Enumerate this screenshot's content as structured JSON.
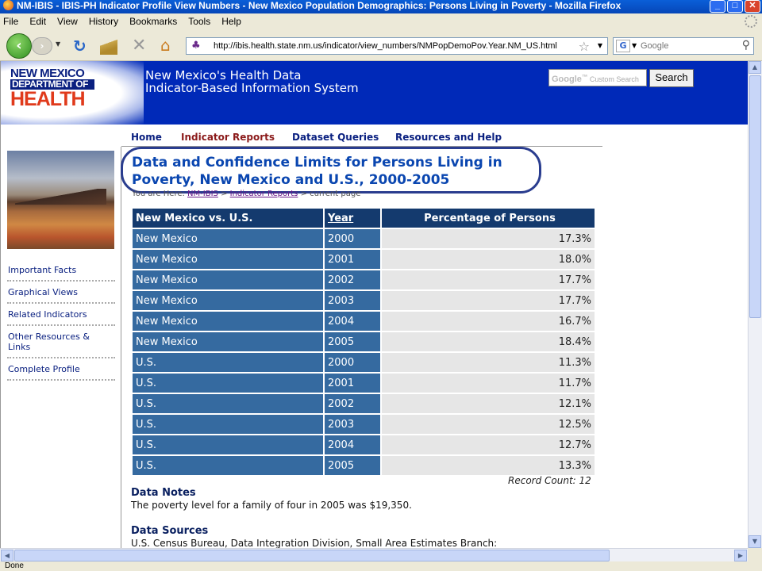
{
  "window": {
    "title": "NM-IBIS - IBIS-PH Indicator Profile View Numbers - New Mexico Population Demographics: Persons Living in Poverty - Mozilla Firefox"
  },
  "menu": [
    "File",
    "Edit",
    "View",
    "History",
    "Bookmarks",
    "Tools",
    "Help"
  ],
  "toolbar": {
    "url": "http://ibis.health.state.nm.us/indicator/view_numbers/NMPopDemoPov.Year.NM_US.html",
    "search_placeholder": "Google"
  },
  "site": {
    "logo_line1": "NEW MEXICO",
    "logo_line2": "DEPARTMENT OF",
    "logo_line3": "HEALTH",
    "title_line1": "New Mexico's Health Data",
    "title_line2": "Indicator-Based Information System",
    "search_hint": "Custom Search",
    "search_brand": "Google",
    "search_button": "Search"
  },
  "nav": {
    "home": "Home",
    "indicator_reports": "Indicator Reports",
    "dataset_queries": "Dataset Queries",
    "resources": "Resources and Help"
  },
  "sidebar": {
    "links": [
      "Important Facts",
      "Graphical Views",
      "Related Indicators",
      "Other Resources & Links",
      "Complete Profile"
    ]
  },
  "page": {
    "title": "Data and Confidence Limits for Persons Living in Poverty, New Mexico and U.S., 2000-2005",
    "breadcrumb_prefix": "You are Here:",
    "breadcrumb_1": "NM-IBIS",
    "breadcrumb_sep": ">",
    "breadcrumb_2": "Indicator Reports",
    "breadcrumb_current": "> current page"
  },
  "table": {
    "headers": [
      "New Mexico vs. U.S.",
      "Year",
      "Percentage of Persons"
    ],
    "rows": [
      [
        "New Mexico",
        "2000",
        "17.3%"
      ],
      [
        "New Mexico",
        "2001",
        "18.0%"
      ],
      [
        "New Mexico",
        "2002",
        "17.7%"
      ],
      [
        "New Mexico",
        "2003",
        "17.7%"
      ],
      [
        "New Mexico",
        "2004",
        "16.7%"
      ],
      [
        "New Mexico",
        "2005",
        "18.4%"
      ],
      [
        "U.S.",
        "2000",
        "11.3%"
      ],
      [
        "U.S.",
        "2001",
        "11.7%"
      ],
      [
        "U.S.",
        "2002",
        "12.1%"
      ],
      [
        "U.S.",
        "2003",
        "12.5%"
      ],
      [
        "U.S.",
        "2004",
        "12.7%"
      ],
      [
        "U.S.",
        "2005",
        "13.3%"
      ]
    ],
    "record_count": "Record Count: 12"
  },
  "notes": {
    "heading": "Data Notes",
    "text": "The poverty level for a family of four in 2005 was $19,350."
  },
  "sources": {
    "heading": "Data Sources",
    "text": "U.S. Census Bureau, Data Integration Division, Small Area Estimates Branch:"
  },
  "status": "Done"
}
